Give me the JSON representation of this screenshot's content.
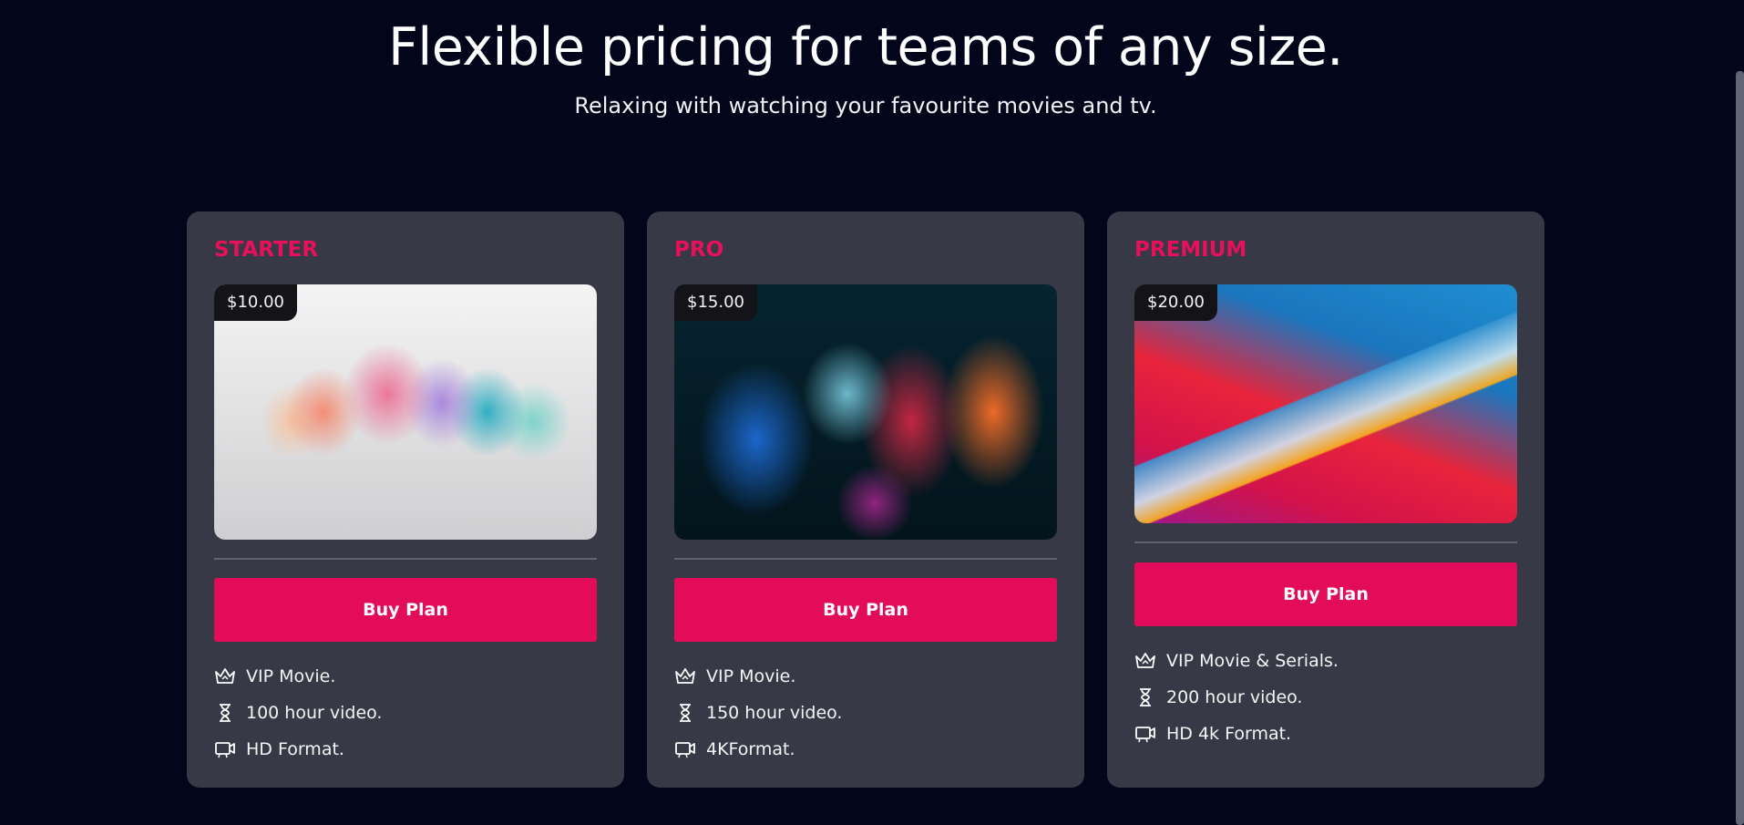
{
  "header": {
    "title": "Flexible pricing for teams of any size.",
    "subtitle": "Relaxing with watching your favourite movies and tv."
  },
  "plans": [
    {
      "name": "STARTER",
      "price": "$10.00",
      "button_label": "Buy Plan",
      "features": [
        {
          "icon": "crown-icon",
          "text": "VIP Movie."
        },
        {
          "icon": "hourglass-icon",
          "text": "100 hour video."
        },
        {
          "icon": "video-format-icon",
          "text": "HD Format."
        }
      ]
    },
    {
      "name": "PRO",
      "price": "$15.00",
      "button_label": "Buy Plan",
      "features": [
        {
          "icon": "crown-icon",
          "text": "VIP Movie."
        },
        {
          "icon": "hourglass-icon",
          "text": "150 hour video."
        },
        {
          "icon": "video-format-icon",
          "text": "4KFormat."
        }
      ]
    },
    {
      "name": "PREMIUM",
      "price": "$20.00",
      "button_label": "Buy Plan",
      "features": [
        {
          "icon": "crown-icon",
          "text": "VIP Movie & Serials."
        },
        {
          "icon": "hourglass-icon",
          "text": "200 hour video."
        },
        {
          "icon": "video-format-icon",
          "text": "HD 4k Format."
        }
      ]
    }
  ],
  "colors": {
    "background": "#03051a",
    "card": "#373a46",
    "accent": "#e20c58",
    "plan_name": "#e6115a"
  }
}
